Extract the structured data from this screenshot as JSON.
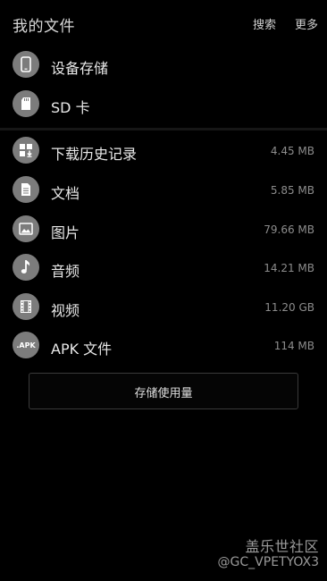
{
  "header": {
    "title": "我的文件",
    "search_label": "搜索",
    "more_label": "更多"
  },
  "storage": [
    {
      "label": "设备存储",
      "icon": "phone-icon"
    },
    {
      "label": "SD 卡",
      "icon": "sd-card-icon"
    }
  ],
  "categories": [
    {
      "label": "下载历史记录",
      "size": "4.45 MB",
      "icon": "download-history-icon"
    },
    {
      "label": "文档",
      "size": "5.85 MB",
      "icon": "document-icon"
    },
    {
      "label": "图片",
      "size": "79.66 MB",
      "icon": "image-icon"
    },
    {
      "label": "音频",
      "size": "14.21 MB",
      "icon": "music-note-icon"
    },
    {
      "label": "视频",
      "size": "11.20 GB",
      "icon": "video-icon"
    },
    {
      "label": "APK 文件",
      "size": "114 MB",
      "icon": "apk-icon",
      "icon_text": ".APK"
    }
  ],
  "storage_usage_button": "存储使用量",
  "watermark": {
    "line1": "盖乐世社区",
    "line2": "@GC_VPETYOX3"
  },
  "colors": {
    "background": "#000000",
    "icon_circle": "#7c7c7c",
    "secondary_text": "#8c8c8c"
  }
}
